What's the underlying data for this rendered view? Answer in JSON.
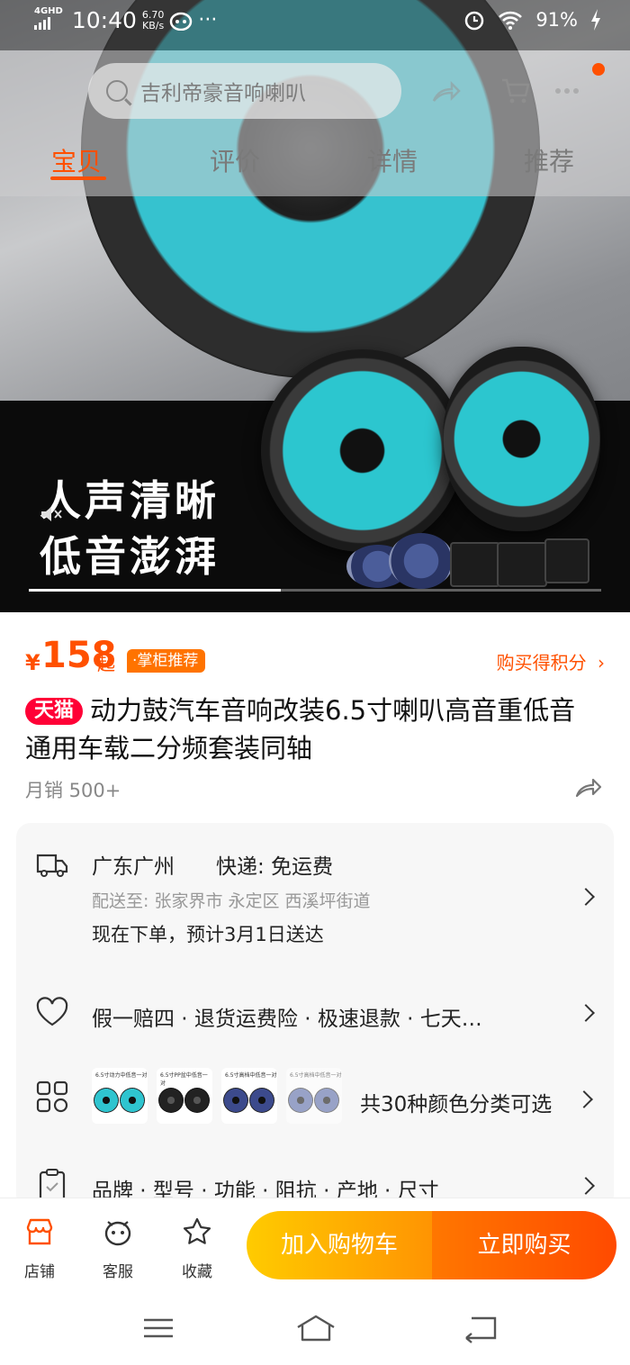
{
  "status_bar": {
    "network": "4GHD",
    "time": "10:40",
    "speed_value": "6.70",
    "speed_unit": "KB/s",
    "more": "···",
    "battery": "91%"
  },
  "header": {
    "search_placeholder": "吉利帝豪音响喇叭",
    "tabs": [
      {
        "label": "宝贝",
        "active": true
      },
      {
        "label": "评价",
        "active": false
      },
      {
        "label": "详情",
        "active": false
      },
      {
        "label": "推荐",
        "active": false
      }
    ]
  },
  "gallery": {
    "caption_line1": "人声清晰",
    "caption_line2": "低音澎湃",
    "progress": 0.44
  },
  "product": {
    "currency": "¥",
    "price": "158",
    "price_suffix": "起",
    "recommend_badge": "·掌柜推荐",
    "points_link": "购买得积分",
    "tmall_badge": "天猫",
    "title": "动力鼓汽车音响改装6.5寸喇叭高音重低音通用车载二分频套装同轴",
    "monthly_sales": "月销 500+"
  },
  "info": {
    "origin": "广东广州",
    "shipping": "快递: 免运费",
    "deliver_to": "配送至: 张家界市 永定区 西溪坪街道",
    "eta": "现在下单，预计3月1日送达",
    "guarantees": "假一赔四 · 退货运费险 · 极速退款 · 七天…",
    "variant_count": "共30种颜色分类可选",
    "variant_thumbs": [
      {
        "caption": "6.5寸动力中低音一对",
        "color": "#2fc4cf"
      },
      {
        "caption": "6.5寸PP盆中低音一对",
        "color": "#222222"
      },
      {
        "caption": "6.5寸高档中低音一对",
        "color": "#3c4a8c"
      },
      {
        "caption": "6.5寸高档中低音一对",
        "color": "#5a6aa8"
      }
    ],
    "params": "品牌 · 型号 · 功能 · 阻抗 · 产地 · 尺寸"
  },
  "bottom_bar": {
    "shop": "店铺",
    "service": "客服",
    "favorite": "收藏",
    "add_to_cart": "加入购物车",
    "buy_now": "立即购买"
  },
  "colors": {
    "accent": "#ff5000",
    "tmall": "#ff0036",
    "cart_gradient_start": "#ffcb00",
    "buy_gradient_end": "#ff4a00"
  }
}
